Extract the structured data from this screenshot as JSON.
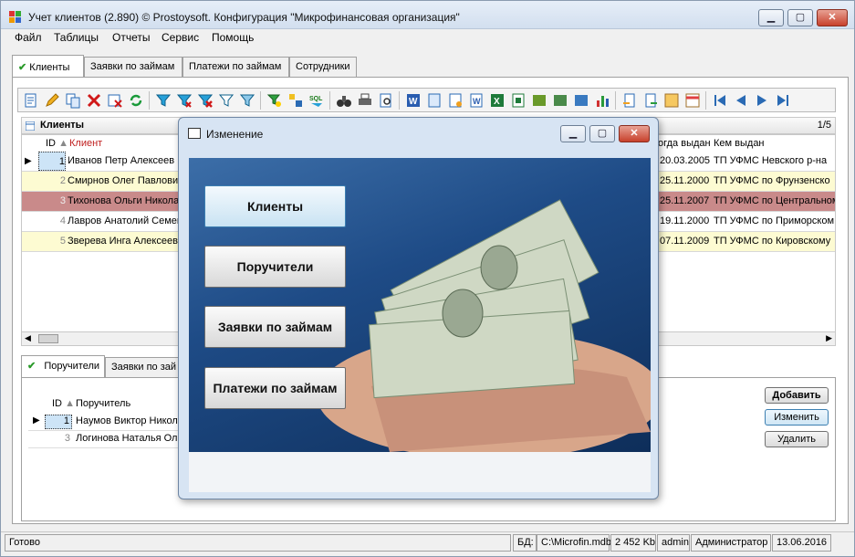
{
  "window": {
    "title": "Учет клиентов (2.890) © Prostoysoft. Конфигурация \"Микрофинансовая организация\""
  },
  "menu": [
    "Файл",
    "Таблицы",
    "Отчеты",
    "Сервис",
    "Помощь"
  ],
  "tabs": [
    "Клиенты",
    "Заявки по займам",
    "Платежи по займам",
    "Сотрудники"
  ],
  "clients_grid": {
    "header": "Клиенты",
    "page_count": "1/5",
    "columns": {
      "id": "ID",
      "client": "Клиент",
      "issue_date": "огда выдан",
      "issued_by": "Кем выдан"
    },
    "rows": [
      {
        "id": "1",
        "client": "Иванов Петр Алексеев",
        "date": "20.03.2005",
        "by": "ТП УФМС Невского р-на",
        "bg": "#ffffff"
      },
      {
        "id": "2",
        "client": "Смирнов Олег Павлович",
        "date": "25.11.2000",
        "by": "ТП УФМС по Фрунзенско",
        "bg": "#fdfbd2"
      },
      {
        "id": "3",
        "client": "Тихонова Ольги Никола",
        "date": "25.11.2007",
        "by": "ТП УФМС по Центральном",
        "bg": "#c98a8a"
      },
      {
        "id": "4",
        "client": "Лавров Анатолий Семен",
        "date": "19.11.2000",
        "by": "ТП УФМС по Приморском",
        "bg": "#ffffff"
      },
      {
        "id": "5",
        "client": "Зверева Инга Алексеев",
        "date": "07.11.2009",
        "by": "ТП УФМС по Кировскому",
        "bg": "#fdfbd2"
      }
    ]
  },
  "bottom_tabs": [
    "Поручители",
    "Заявки по зай"
  ],
  "guarantors": {
    "columns": {
      "id": "ID",
      "name": "Поручитель"
    },
    "rows": [
      {
        "id": "1",
        "name": "Наумов Виктор Никол"
      },
      {
        "id": "3",
        "name": "Логинова Наталья Оле"
      }
    ]
  },
  "side_buttons": {
    "add": "Добавить",
    "edit": "Изменить",
    "delete": "Удалить"
  },
  "dialog": {
    "title": "Изменение",
    "buttons": [
      "Клиенты",
      "Поручители",
      "Заявки по займам",
      "Платежи по займам"
    ]
  },
  "status": {
    "ready": "Готово",
    "db_label": "БД:",
    "db_path": "C:\\Microfin.mdb",
    "db_size": "2 452 Kb",
    "user": "admin",
    "role": "Администратор",
    "date": "13.06.2016"
  }
}
